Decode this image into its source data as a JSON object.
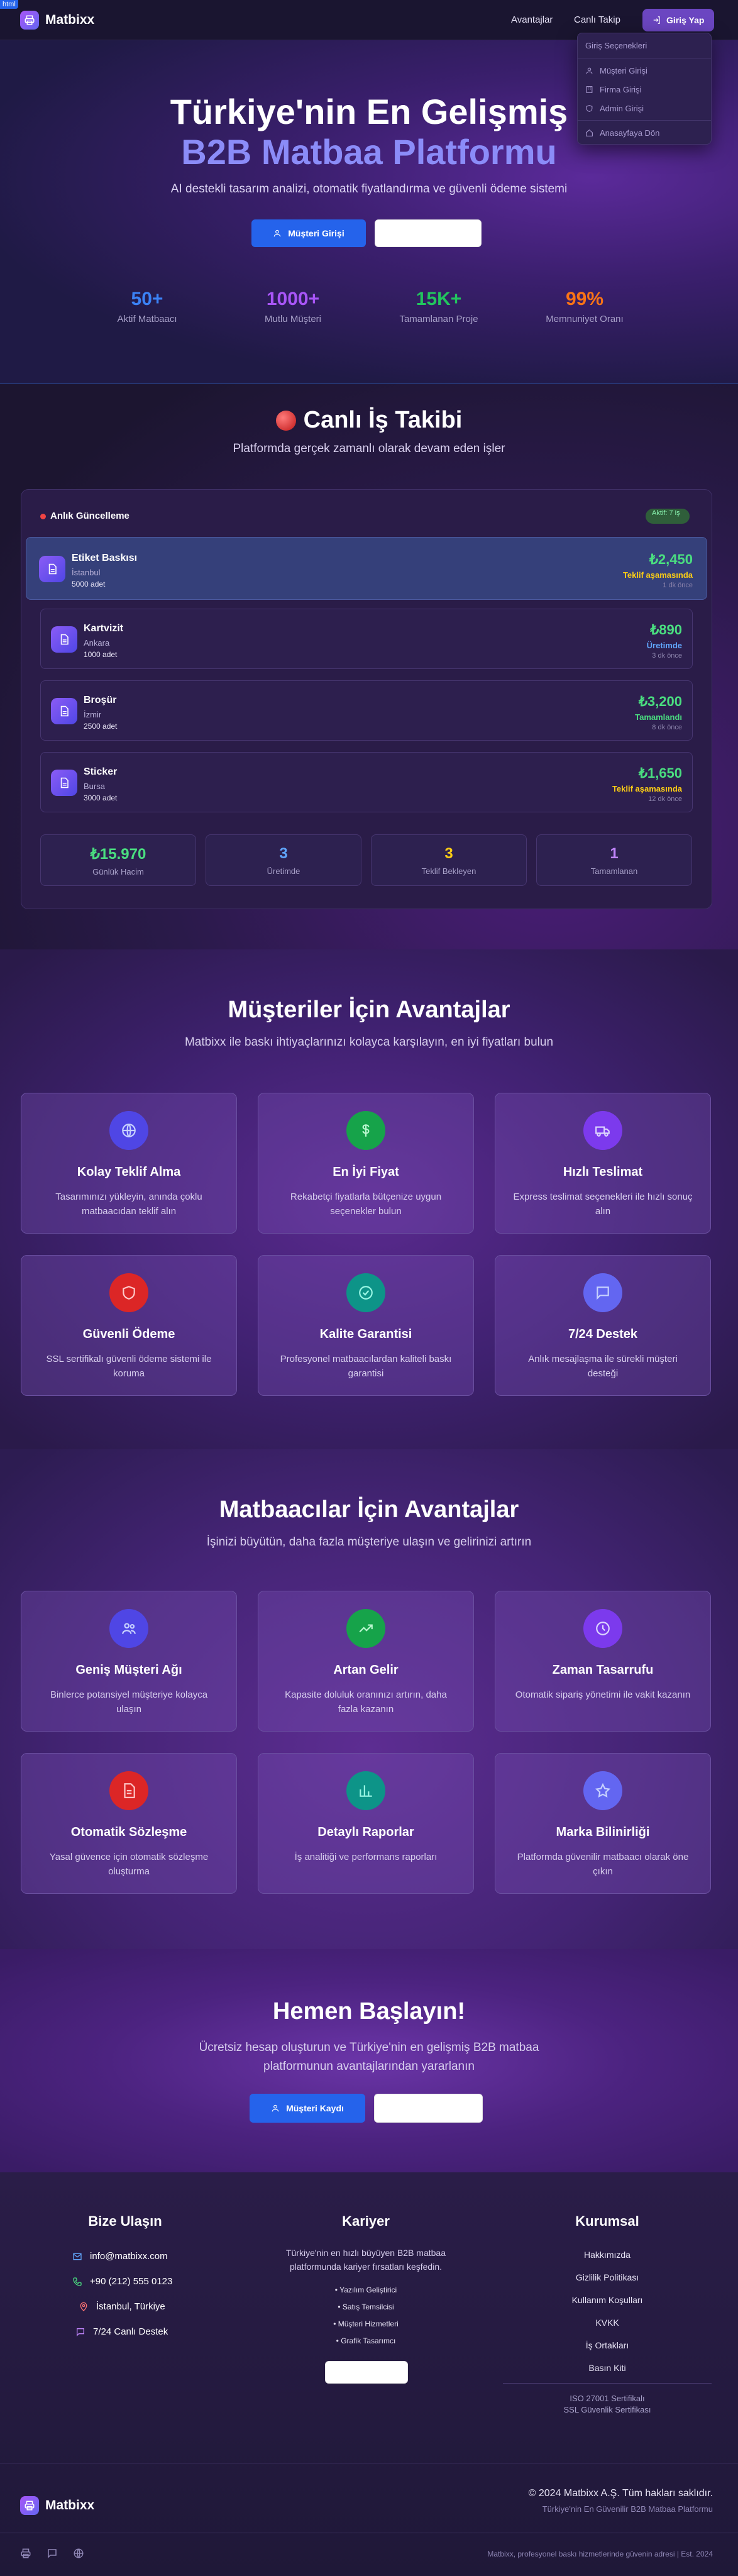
{
  "nav": {
    "brand": "Matbixx",
    "links": [
      "Avantajlar",
      "Canlı Takip"
    ],
    "login": "Giriş Yap",
    "badge": "html"
  },
  "dropdown": {
    "header": "Giriş Seçenekleri",
    "items": [
      {
        "icon": "user-icon",
        "label": "Müşteri Girişi"
      },
      {
        "icon": "building-icon",
        "label": "Firma Girişi"
      },
      {
        "icon": "shield-icon",
        "label": "Admin Girişi"
      },
      {
        "icon": "home-icon",
        "label": "Anasayfaya Dön"
      }
    ]
  },
  "hero": {
    "title1": "Türkiye'nin En Gelişmiş",
    "title2": "B2B Matbaa Platformu",
    "subtitle": "AI destekli tasarım analizi, otomatik fiyatlandırma ve güvenli ödeme sistemi",
    "cta": "Müşteri Girişi",
    "stats": [
      {
        "value": "50+",
        "label": "Aktif Matbaacı",
        "color": "#3b82f6"
      },
      {
        "value": "1000+",
        "label": "Mutlu Müşteri",
        "color": "#a855f7"
      },
      {
        "value": "15K+",
        "label": "Tamamlanan Proje",
        "color": "#22c55e"
      },
      {
        "value": "99%",
        "label": "Memnuniyet Oranı",
        "color": "#f97316"
      }
    ]
  },
  "live": {
    "title": "Canlı İş Takibi",
    "subtitle": "Platformda gerçek zamanlı olarak devam eden işler",
    "panel_title": "Anlık Güncelleme",
    "active": "Aktif: 7 iş",
    "jobs": [
      {
        "name": "Etiket Baskısı",
        "city": "İstanbul",
        "qty": "5000 adet",
        "price": "₺2,450",
        "status": "Teklif aşamasında",
        "status_color": "#facc15",
        "time": "1 dk önce"
      },
      {
        "name": "Kartvizit",
        "city": "Ankara",
        "qty": "1000 adet",
        "price": "₺890",
        "status": "Üretimde",
        "status_color": "#60a5fa",
        "time": "3 dk önce"
      },
      {
        "name": "Broşür",
        "city": "İzmir",
        "qty": "2500 adet",
        "price": "₺3,200",
        "status": "Tamamlandı",
        "status_color": "#4ade80",
        "time": "8 dk önce"
      },
      {
        "name": "Sticker",
        "city": "Bursa",
        "qty": "3000 adet",
        "price": "₺1,650",
        "status": "Teklif aşamasında",
        "status_color": "#facc15",
        "time": "12 dk önce"
      }
    ],
    "summary": [
      {
        "value": "₺15.970",
        "label": "Günlük Hacim",
        "color": "#4ade80"
      },
      {
        "value": "3",
        "label": "Üretimde",
        "color": "#60a5fa"
      },
      {
        "value": "3",
        "label": "Teklif Bekleyen",
        "color": "#facc15"
      },
      {
        "value": "1",
        "label": "Tamamlanan",
        "color": "#c084fc"
      }
    ]
  },
  "customers": {
    "title": "Müşteriler İçin Avantajlar",
    "subtitle": "Matbixx ile baskı ihtiyaçlarınızı kolayca karşılayın, en iyi fiyatları bulun",
    "items": [
      {
        "icon": "globe-icon",
        "title": "Kolay Teklif Alma",
        "desc": "Tasarımınızı yükleyin, anında çoklu matbaacıdan teklif alın",
        "color": "#4f46e5"
      },
      {
        "icon": "dollar-icon",
        "title": "En İyi Fiyat",
        "desc": "Rekabetçi fiyatlarla bütçenize uygun seçenekler bulun",
        "color": "#16a34a"
      },
      {
        "icon": "truck-icon",
        "title": "Hızlı Teslimat",
        "desc": "Express teslimat seçenekleri ile hızlı sonuç alın",
        "color": "#7c3aed"
      },
      {
        "icon": "shield-icon",
        "title": "Güvenli Ödeme",
        "desc": "SSL sertifikalı güvenli ödeme sistemi ile koruma",
        "color": "#dc2626"
      },
      {
        "icon": "check-icon",
        "title": "Kalite Garantisi",
        "desc": "Profesyonel matbaacılardan kaliteli baskı garantisi",
        "color": "#0d9488"
      },
      {
        "icon": "chat-icon",
        "title": "7/24 Destek",
        "desc": "Anlık mesajlaşma ile sürekli müşteri desteği",
        "color": "#6366f1"
      }
    ]
  },
  "printers": {
    "title": "Matbaacılar İçin Avantajlar",
    "subtitle": "İşinizi büyütün, daha fazla müşteriye ulaşın ve gelirinizi artırın",
    "items": [
      {
        "icon": "users-icon",
        "title": "Geniş Müşteri Ağı",
        "desc": "Binlerce potansiyel müşteriye kolayca ulaşın",
        "color": "#4f46e5"
      },
      {
        "icon": "trending-up-icon",
        "title": "Artan Gelir",
        "desc": "Kapasite doluluk oranınızı artırın, daha fazla kazanın",
        "color": "#16a34a"
      },
      {
        "icon": "clock-icon",
        "title": "Zaman Tasarrufu",
        "desc": "Otomatik sipariş yönetimi ile vakit kazanın",
        "color": "#7c3aed"
      },
      {
        "icon": "document-icon",
        "title": "Otomatik Sözleşme",
        "desc": "Yasal güvence için otomatik sözleşme oluşturma",
        "color": "#dc2626"
      },
      {
        "icon": "chart-icon",
        "title": "Detaylı Raporlar",
        "desc": "İş analitiği ve performans raporları",
        "color": "#0d9488"
      },
      {
        "icon": "star-icon",
        "title": "Marka Bilinirliği",
        "desc": "Platformda güvenilir matbaacı olarak öne çıkın",
        "color": "#6366f1"
      }
    ]
  },
  "cta": {
    "title": "Hemen Başlayın!",
    "subtitle1": "Ücretsiz hesap oluşturun ve Türkiye'nin en gelişmiş B2B matbaa",
    "subtitle2": "platformunun avantajlarından yararlanın",
    "button": "Müşteri Kaydı"
  },
  "footer": {
    "contact": {
      "title": "Bize Ulaşın",
      "items": [
        {
          "icon": "mail-icon",
          "text": "info@matbixx.com",
          "color": "#60a5fa"
        },
        {
          "icon": "phone-icon",
          "text": "+90 (212) 555 0123",
          "color": "#4ade80"
        },
        {
          "icon": "pin-icon",
          "text": "İstanbul, Türkiye",
          "color": "#f87171"
        },
        {
          "icon": "chat-icon",
          "text": "7/24 Canlı Destek",
          "color": "#c084fc"
        }
      ]
    },
    "career": {
      "title": "Kariyer",
      "desc1": "Türkiye'nin en hızlı büyüyen B2B matbaa",
      "desc2": "platformunda kariyer fırsatları keşfedin.",
      "roles": [
        "• Yazılım Geliştirici",
        "• Satış Temsilcisi",
        "• Müşteri Hizmetleri",
        "• Grafik Tasarımcı"
      ]
    },
    "corporate": {
      "title": "Kurumsal",
      "links": [
        "Hakkımızda",
        "Gizlilik Politikası",
        "Kullanım Koşulları",
        "KVKK",
        "İş Ortakları",
        "Basın Kiti"
      ],
      "certs": [
        "ISO 27001 Sertifikalı",
        "SSL Güvenlik Sertifikası"
      ]
    },
    "copyright": "© 2024 Matbixx A.Ş. Tüm hakları saklıdır.",
    "tagline": "Türkiye'nin En Güvenilir B2B Matbaa Platformu",
    "bottom_note": "Matbixx, profesyonel baskı hizmetlerinde güvenin adresi | Est. 2024"
  }
}
